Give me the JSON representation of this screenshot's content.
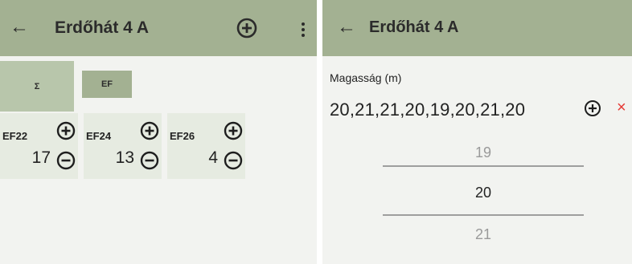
{
  "left": {
    "title": "Erdőhát 4 A",
    "tabs": [
      {
        "label": "Σ",
        "selected": true
      },
      {
        "label": "EF",
        "selected": false
      }
    ],
    "counters": [
      {
        "name": "EF22",
        "value": "17"
      },
      {
        "name": "EF24",
        "value": "13"
      },
      {
        "name": "EF26",
        "value": "4"
      }
    ]
  },
  "right": {
    "title": "Erdőhát 4 A",
    "field_label": "Magasság (m)",
    "field_value": "20,21,21,20,19,20,21,20",
    "picker": {
      "previous": "19",
      "selected": "20",
      "next": "21"
    }
  },
  "icons": {
    "back": "arrow-back-icon",
    "add": "add-circle-icon",
    "remove": "remove-circle-icon",
    "more": "more-vert-icon",
    "close": "close-icon"
  },
  "colors": {
    "appbar": "#a3b192",
    "tab_selected": "#b8c6ab",
    "counter_bg": "#e6ebe1",
    "background": "#f2f3f0",
    "delete_red": "#e53935"
  }
}
